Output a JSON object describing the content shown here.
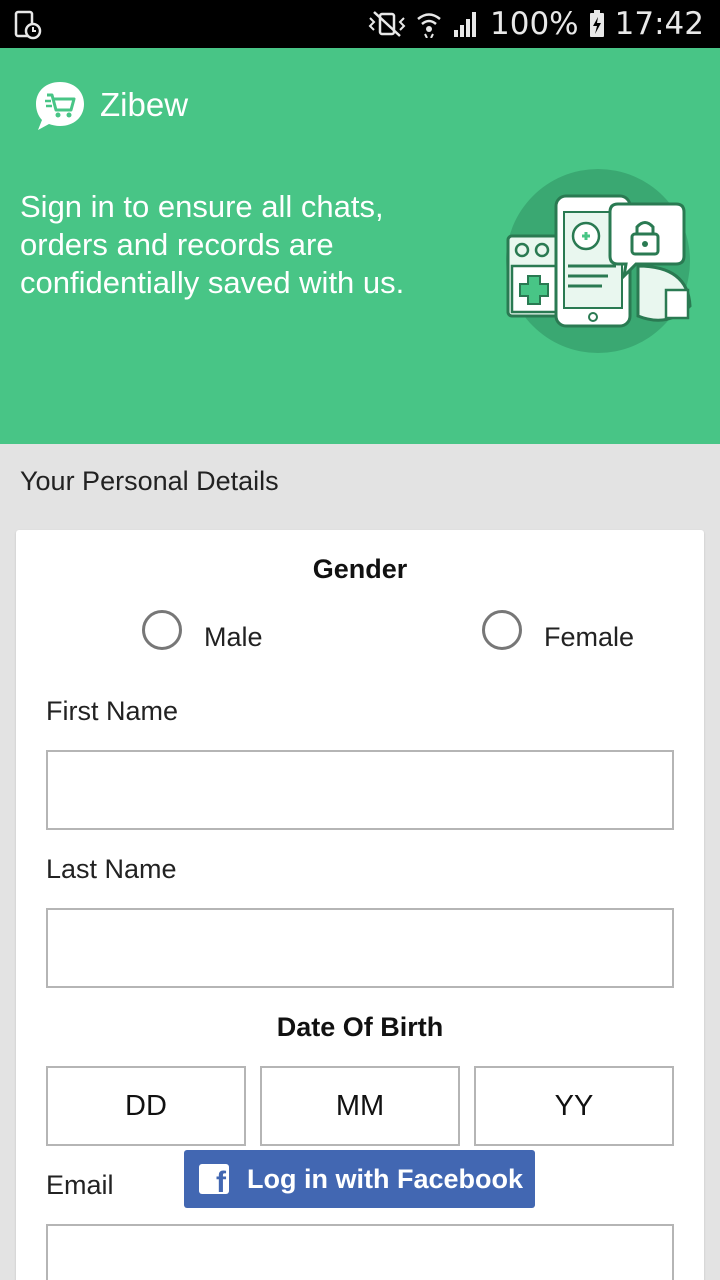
{
  "status_bar": {
    "battery": "100%",
    "time": "17:42"
  },
  "header": {
    "app_name": "Zibew",
    "tagline": "Sign in to ensure all chats, orders and records are confidentially saved with us.",
    "background_color": "#48c586"
  },
  "section_title": "Your Personal Details",
  "form": {
    "gender": {
      "heading": "Gender",
      "options": [
        "Male",
        "Female"
      ]
    },
    "first_name": {
      "label": "First Name",
      "value": ""
    },
    "last_name": {
      "label": "Last Name",
      "value": ""
    },
    "dob": {
      "heading": "Date Of Birth",
      "day": "DD",
      "month": "MM",
      "year": "YY"
    },
    "email": {
      "label": "Email",
      "value": ""
    }
  },
  "facebook_button": {
    "label": "Log in with Facebook",
    "color": "#4267b2"
  }
}
